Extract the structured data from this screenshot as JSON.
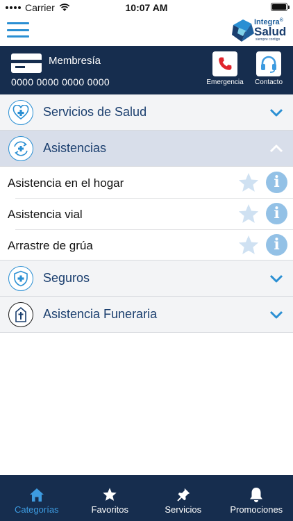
{
  "status_bar": {
    "carrier": "Carrier",
    "time": "10:07 AM"
  },
  "app_bar": {
    "logo": {
      "line1": "Integra",
      "line2": "Salud",
      "tagline": "siempre contigo",
      "registered": "®"
    }
  },
  "membership": {
    "label": "Membresía",
    "number": "0000 0000 0000 0000",
    "actions": [
      {
        "label": "Emergencia",
        "icon": "phone-icon"
      },
      {
        "label": "Contacto",
        "icon": "headset-icon"
      }
    ]
  },
  "categories": [
    {
      "label": "Servicios de Salud",
      "icon": "heart-plus-icon",
      "expanded": false
    },
    {
      "label": "Asistencias",
      "icon": "assistance-hands-icon",
      "expanded": true,
      "items": [
        {
          "label": "Asistencia en el hogar"
        },
        {
          "label": "Asistencia vial"
        },
        {
          "label": "Arrastre de grúa"
        }
      ]
    },
    {
      "label": "Seguros",
      "icon": "shield-plus-icon",
      "expanded": false
    },
    {
      "label": "Asistencia Funeraria",
      "icon": "tomb-cross-icon",
      "expanded": false
    }
  ],
  "tab_bar": {
    "tabs": [
      {
        "label": "Categorías",
        "icon": "home-icon",
        "active": true
      },
      {
        "label": "Favoritos",
        "icon": "star-icon",
        "active": false
      },
      {
        "label": "Servicios",
        "icon": "pin-icon",
        "active": false
      },
      {
        "label": "Promociones",
        "icon": "bell-icon",
        "active": false
      }
    ]
  },
  "colors": {
    "navy": "#162d4e",
    "accent_blue": "#2a8fd3",
    "category_text": "#1a3e6e",
    "active_tab": "#3d9be0",
    "star_inactive": "#cfe1f2",
    "info_bg": "#93c1e6"
  }
}
